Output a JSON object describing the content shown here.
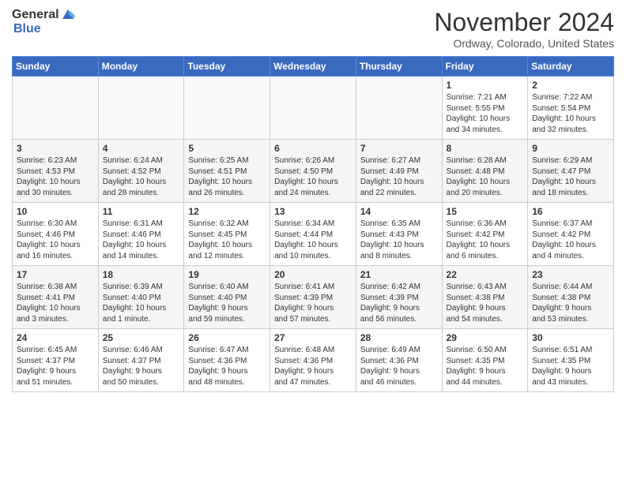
{
  "header": {
    "logo_general": "General",
    "logo_blue": "Blue",
    "month_title": "November 2024",
    "location": "Ordway, Colorado, United States"
  },
  "weekdays": [
    "Sunday",
    "Monday",
    "Tuesday",
    "Wednesday",
    "Thursday",
    "Friday",
    "Saturday"
  ],
  "weeks": [
    [
      {
        "day": "",
        "info": ""
      },
      {
        "day": "",
        "info": ""
      },
      {
        "day": "",
        "info": ""
      },
      {
        "day": "",
        "info": ""
      },
      {
        "day": "",
        "info": ""
      },
      {
        "day": "1",
        "info": "Sunrise: 7:21 AM\nSunset: 5:55 PM\nDaylight: 10 hours\nand 34 minutes."
      },
      {
        "day": "2",
        "info": "Sunrise: 7:22 AM\nSunset: 5:54 PM\nDaylight: 10 hours\nand 32 minutes."
      }
    ],
    [
      {
        "day": "3",
        "info": "Sunrise: 6:23 AM\nSunset: 4:53 PM\nDaylight: 10 hours\nand 30 minutes."
      },
      {
        "day": "4",
        "info": "Sunrise: 6:24 AM\nSunset: 4:52 PM\nDaylight: 10 hours\nand 28 minutes."
      },
      {
        "day": "5",
        "info": "Sunrise: 6:25 AM\nSunset: 4:51 PM\nDaylight: 10 hours\nand 26 minutes."
      },
      {
        "day": "6",
        "info": "Sunrise: 6:26 AM\nSunset: 4:50 PM\nDaylight: 10 hours\nand 24 minutes."
      },
      {
        "day": "7",
        "info": "Sunrise: 6:27 AM\nSunset: 4:49 PM\nDaylight: 10 hours\nand 22 minutes."
      },
      {
        "day": "8",
        "info": "Sunrise: 6:28 AM\nSunset: 4:48 PM\nDaylight: 10 hours\nand 20 minutes."
      },
      {
        "day": "9",
        "info": "Sunrise: 6:29 AM\nSunset: 4:47 PM\nDaylight: 10 hours\nand 18 minutes."
      }
    ],
    [
      {
        "day": "10",
        "info": "Sunrise: 6:30 AM\nSunset: 4:46 PM\nDaylight: 10 hours\nand 16 minutes."
      },
      {
        "day": "11",
        "info": "Sunrise: 6:31 AM\nSunset: 4:46 PM\nDaylight: 10 hours\nand 14 minutes."
      },
      {
        "day": "12",
        "info": "Sunrise: 6:32 AM\nSunset: 4:45 PM\nDaylight: 10 hours\nand 12 minutes."
      },
      {
        "day": "13",
        "info": "Sunrise: 6:34 AM\nSunset: 4:44 PM\nDaylight: 10 hours\nand 10 minutes."
      },
      {
        "day": "14",
        "info": "Sunrise: 6:35 AM\nSunset: 4:43 PM\nDaylight: 10 hours\nand 8 minutes."
      },
      {
        "day": "15",
        "info": "Sunrise: 6:36 AM\nSunset: 4:42 PM\nDaylight: 10 hours\nand 6 minutes."
      },
      {
        "day": "16",
        "info": "Sunrise: 6:37 AM\nSunset: 4:42 PM\nDaylight: 10 hours\nand 4 minutes."
      }
    ],
    [
      {
        "day": "17",
        "info": "Sunrise: 6:38 AM\nSunset: 4:41 PM\nDaylight: 10 hours\nand 3 minutes."
      },
      {
        "day": "18",
        "info": "Sunrise: 6:39 AM\nSunset: 4:40 PM\nDaylight: 10 hours\nand 1 minute."
      },
      {
        "day": "19",
        "info": "Sunrise: 6:40 AM\nSunset: 4:40 PM\nDaylight: 9 hours\nand 59 minutes."
      },
      {
        "day": "20",
        "info": "Sunrise: 6:41 AM\nSunset: 4:39 PM\nDaylight: 9 hours\nand 57 minutes."
      },
      {
        "day": "21",
        "info": "Sunrise: 6:42 AM\nSunset: 4:39 PM\nDaylight: 9 hours\nand 56 minutes."
      },
      {
        "day": "22",
        "info": "Sunrise: 6:43 AM\nSunset: 4:38 PM\nDaylight: 9 hours\nand 54 minutes."
      },
      {
        "day": "23",
        "info": "Sunrise: 6:44 AM\nSunset: 4:38 PM\nDaylight: 9 hours\nand 53 minutes."
      }
    ],
    [
      {
        "day": "24",
        "info": "Sunrise: 6:45 AM\nSunset: 4:37 PM\nDaylight: 9 hours\nand 51 minutes."
      },
      {
        "day": "25",
        "info": "Sunrise: 6:46 AM\nSunset: 4:37 PM\nDaylight: 9 hours\nand 50 minutes."
      },
      {
        "day": "26",
        "info": "Sunrise: 6:47 AM\nSunset: 4:36 PM\nDaylight: 9 hours\nand 48 minutes."
      },
      {
        "day": "27",
        "info": "Sunrise: 6:48 AM\nSunset: 4:36 PM\nDaylight: 9 hours\nand 47 minutes."
      },
      {
        "day": "28",
        "info": "Sunrise: 6:49 AM\nSunset: 4:36 PM\nDaylight: 9 hours\nand 46 minutes."
      },
      {
        "day": "29",
        "info": "Sunrise: 6:50 AM\nSunset: 4:35 PM\nDaylight: 9 hours\nand 44 minutes."
      },
      {
        "day": "30",
        "info": "Sunrise: 6:51 AM\nSunset: 4:35 PM\nDaylight: 9 hours\nand 43 minutes."
      }
    ]
  ]
}
